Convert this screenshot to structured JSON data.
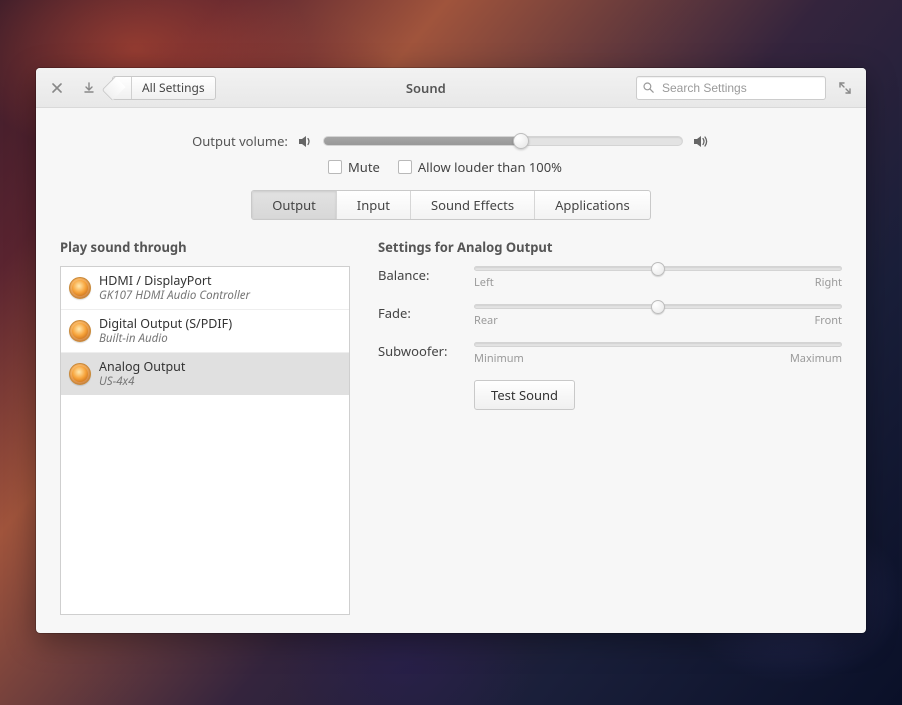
{
  "header": {
    "back_label": "All Settings",
    "title": "Sound",
    "search_placeholder": "Search Settings"
  },
  "volume": {
    "label": "Output volume:",
    "percent": 55,
    "mute_label": "Mute",
    "loud_label": "Allow louder than 100%"
  },
  "tabs": [
    "Output",
    "Input",
    "Sound Effects",
    "Applications"
  ],
  "active_tab": 0,
  "left": {
    "title": "Play sound through",
    "devices": [
      {
        "name": "HDMI / DisplayPort",
        "sub": "GK107 HDMI Audio Controller",
        "selected": false
      },
      {
        "name": "Digital Output (S/PDIF)",
        "sub": "Built-in Audio",
        "selected": false
      },
      {
        "name": "Analog Output",
        "sub": "US-4x4",
        "selected": true
      }
    ]
  },
  "right": {
    "title": "Settings for Analog Output",
    "balance": {
      "label": "Balance:",
      "left": "Left",
      "right": "Right",
      "value": 50
    },
    "fade": {
      "label": "Fade:",
      "left": "Rear",
      "right": "Front",
      "value": 50
    },
    "sub": {
      "label": "Subwoofer:",
      "left": "Minimum",
      "right": "Maximum",
      "value": 0
    },
    "test_label": "Test Sound"
  }
}
